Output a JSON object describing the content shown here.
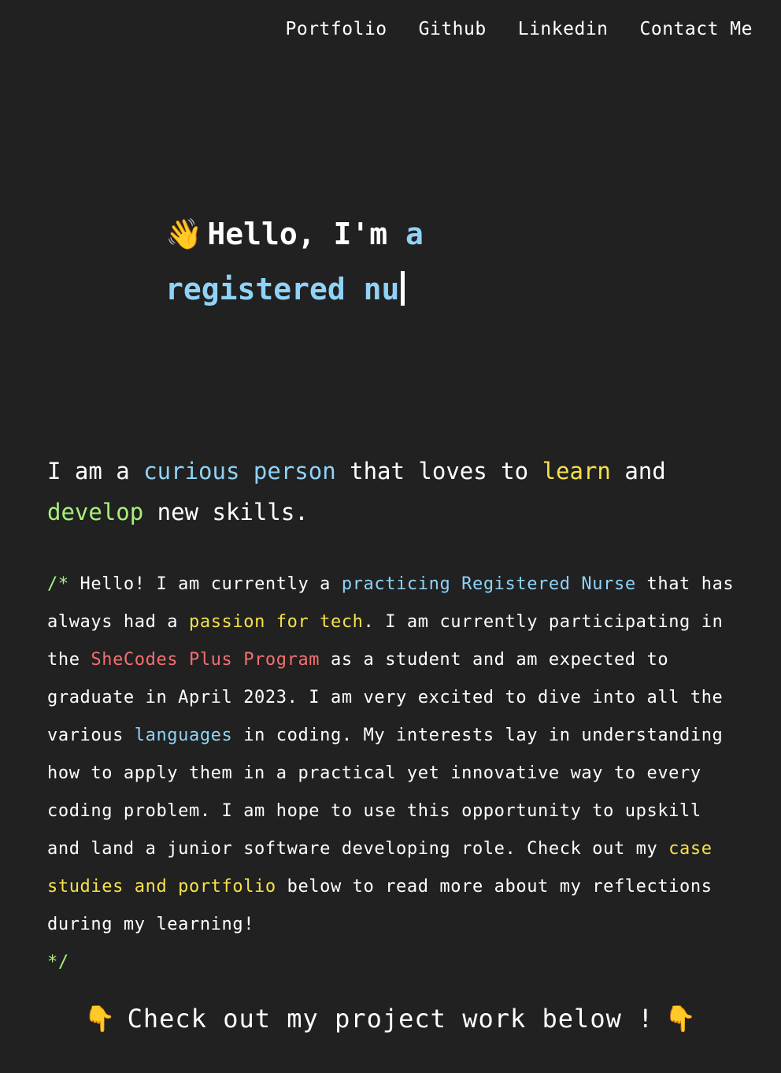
{
  "nav": {
    "items": [
      "Portfolio",
      "Github",
      "Linkedin",
      "Contact Me"
    ]
  },
  "hero": {
    "emoji": "👋",
    "greeting": "Hello, I'm",
    "typed_word_1": "a",
    "typed_text_2": "registered nu"
  },
  "intro": {
    "p1": "I am a ",
    "h1": "curious person",
    "p2": " that loves to ",
    "h2": "learn",
    "p3": " and ",
    "h3": "develop",
    "p4": " new skills."
  },
  "bio": {
    "open": "/*",
    "t1": " Hello! I am currently a ",
    "h1": "practicing Registered Nurse",
    "t2": " that has always had a ",
    "h2": "passion for tech",
    "t3": ". I am currently participating in the ",
    "h3": "SheCodes Plus Program",
    "t4": " as a student and am expected to graduate in April 2023. I am very excited to dive into all the various ",
    "h4": "languages",
    "t5": " in coding. My interests lay in understanding how to apply them in a practical yet innovative way to every coding problem. I am hope to use this opportunity to upskill and land a junior software developing role. Check out my ",
    "h5": "case studies and portfolio",
    "t6": " below to read more about my reflections during my learning!",
    "close": "*/"
  },
  "cta": {
    "emoji_left": "👇",
    "text": "Check out my project work below !",
    "emoji_right": "👇"
  },
  "colors": {
    "background": "#212121",
    "blue": "#8fd3f7",
    "yellow": "#f7e14b",
    "green": "#a8f07a",
    "red": "#f46f6f"
  }
}
